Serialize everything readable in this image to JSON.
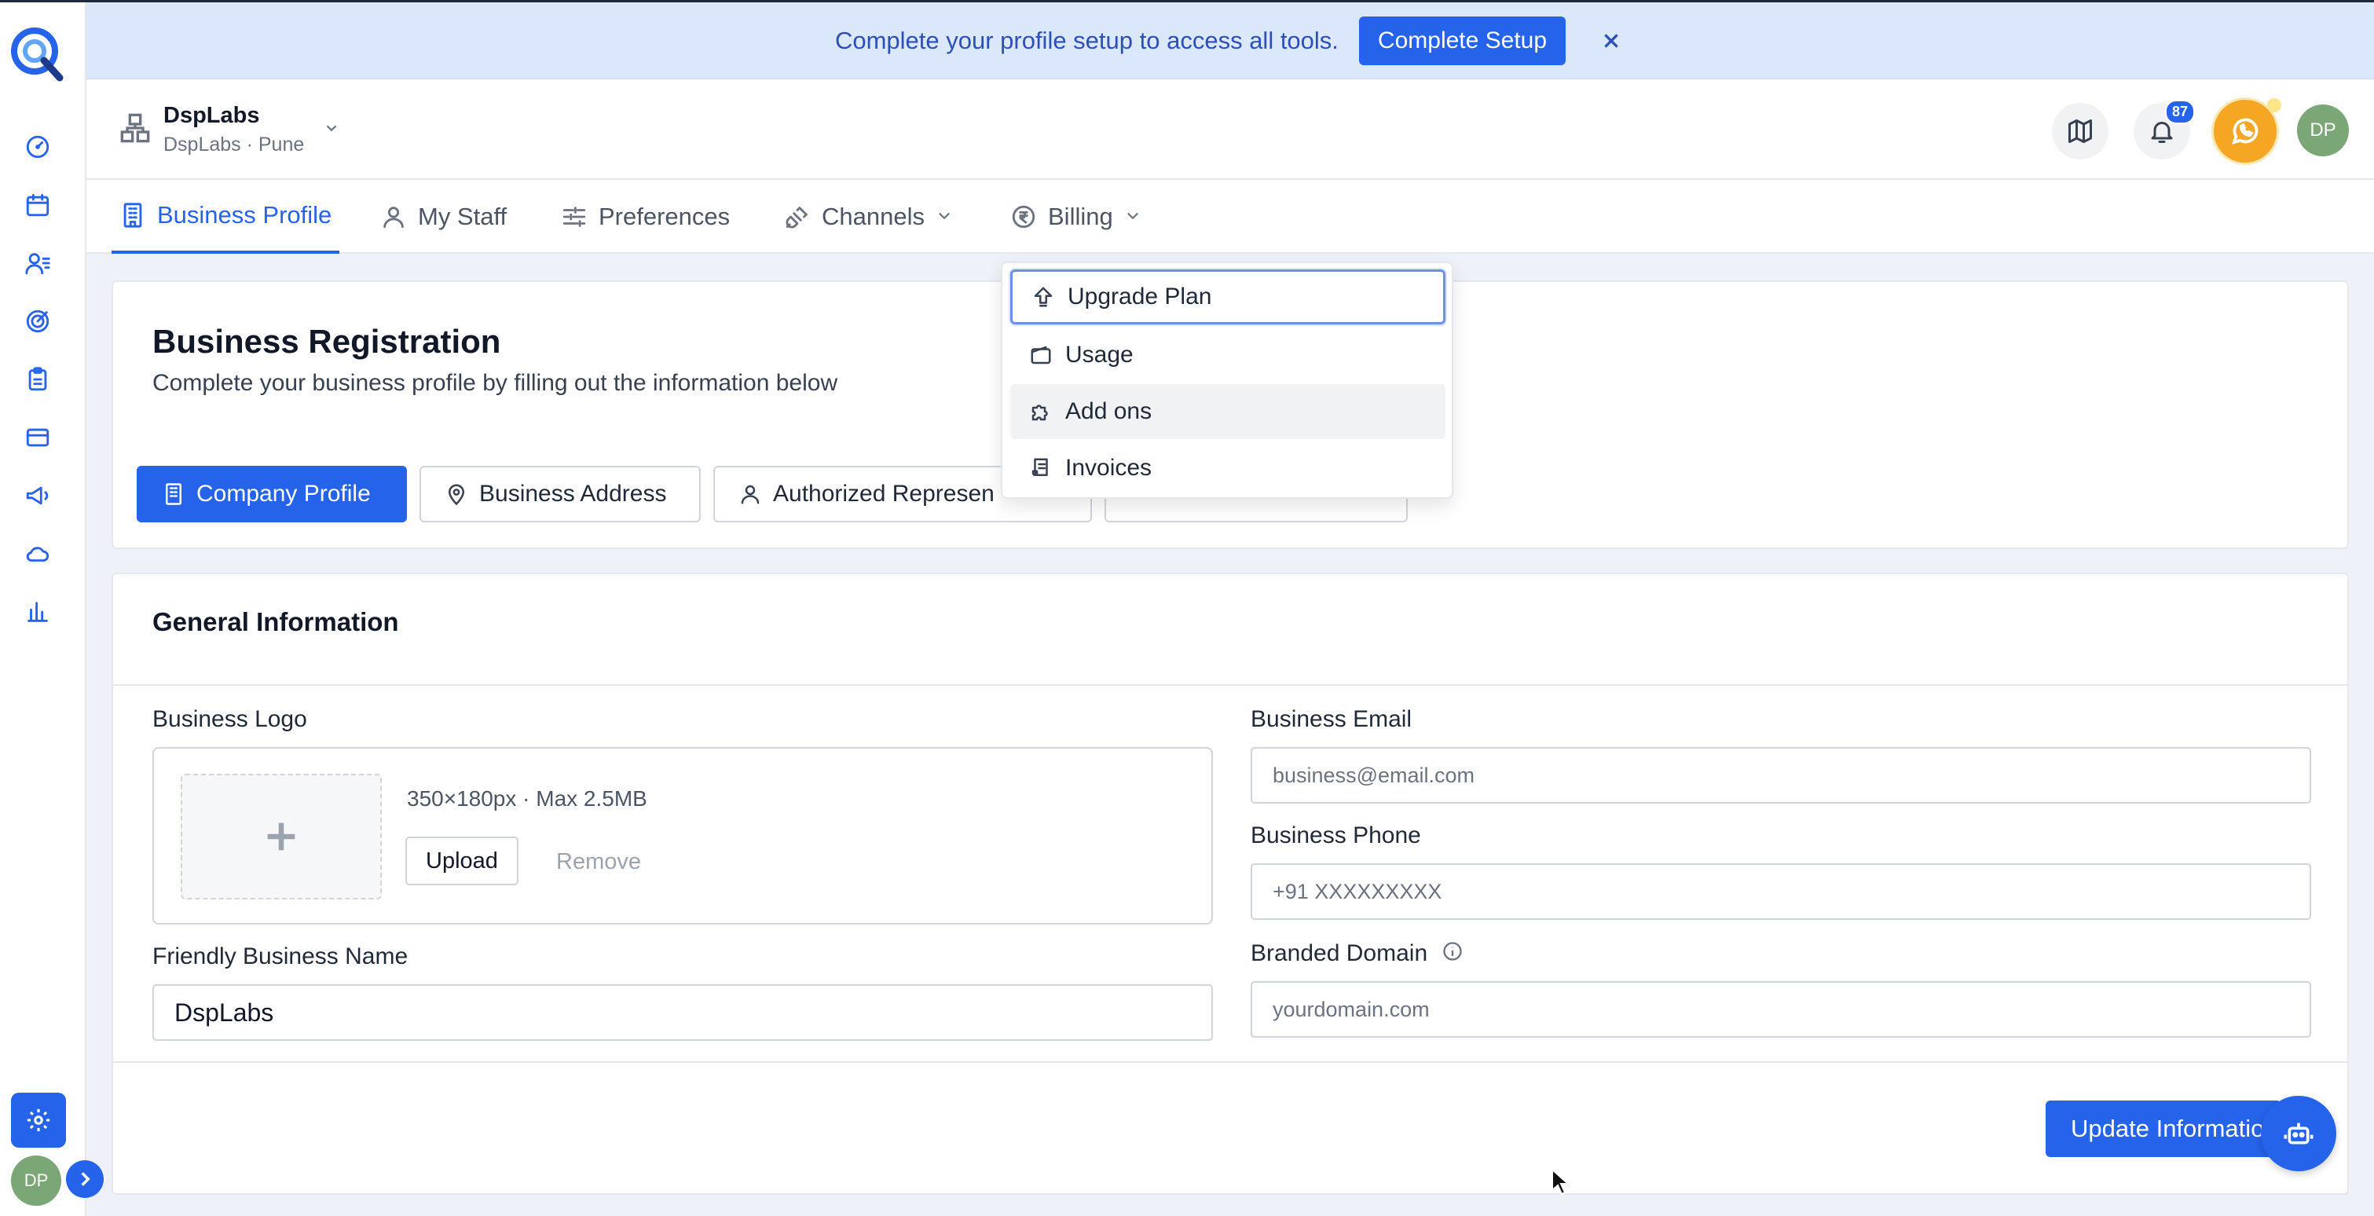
{
  "banner": {
    "message": "Complete your profile setup to access all tools.",
    "button_label": "Complete Setup"
  },
  "org": {
    "name": "DspLabs",
    "subtitle": "DspLabs · Pune"
  },
  "header": {
    "notification_count": "87",
    "avatar_initials": "DP"
  },
  "sidebar": {
    "items": [
      "dashboard-icon",
      "calendar-icon",
      "contacts-icon",
      "target-icon",
      "clipboard-icon",
      "card-icon",
      "megaphone-icon",
      "cloud-icon",
      "bar-chart-icon"
    ],
    "avatar_initials": "DP"
  },
  "tabs": [
    {
      "label": "Business Profile",
      "active": true
    },
    {
      "label": "My Staff"
    },
    {
      "label": "Preferences"
    },
    {
      "label": "Channels"
    },
    {
      "label": "Billing"
    }
  ],
  "billing_menu": [
    {
      "label": "Upgrade Plan"
    },
    {
      "label": "Usage"
    },
    {
      "label": "Add ons"
    },
    {
      "label": "Invoices"
    }
  ],
  "registration": {
    "title": "Business Registration",
    "subtitle": "Complete your business profile by filling out the information below"
  },
  "steps": [
    {
      "label": "Company Profile",
      "active": true
    },
    {
      "label": "Business Address"
    },
    {
      "label": "Authorized Represen"
    }
  ],
  "general": {
    "title": "General Information",
    "logo_label": "Business Logo",
    "logo_spec": "350×180px · Max 2.5MB",
    "upload_label": "Upload",
    "remove_label": "Remove",
    "friendly_name_label": "Friendly Business Name",
    "friendly_name_value": "DspLabs",
    "email_label": "Business Email",
    "email_placeholder": "business@email.com",
    "phone_label": "Business Phone",
    "phone_placeholder": "+91 XXXXXXXXX",
    "domain_label": "Branded Domain",
    "domain_placeholder": "yourdomain.com",
    "update_label": "Update Informatio"
  },
  "colors": {
    "accent": "#2563eb",
    "banner_bg": "#dbe7fb",
    "whatsapp": "#f5a623",
    "avatar": "#7aa775"
  }
}
